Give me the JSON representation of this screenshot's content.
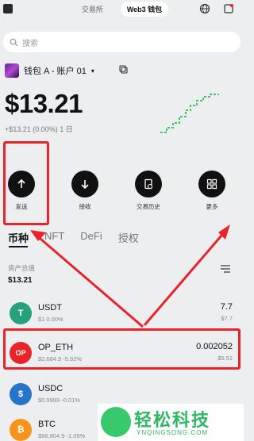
{
  "header": {
    "tabs": [
      {
        "label": "交易所",
        "active": false
      },
      {
        "label": "Web3 钱包",
        "active": true
      }
    ]
  },
  "search": {
    "placeholder": "搜索"
  },
  "account": {
    "name": "钱包 A - 账户 01"
  },
  "balance": {
    "total": "$13.21",
    "change": "+$13.21 (0.00%) 1 日"
  },
  "actions": [
    {
      "label": "发送",
      "icon": "arrow-up-icon"
    },
    {
      "label": "接收",
      "icon": "arrow-down-icon"
    },
    {
      "label": "交易历史",
      "icon": "history-icon"
    },
    {
      "label": "更多",
      "icon": "grid-icon"
    }
  ],
  "category_tabs": [
    {
      "label": "币种",
      "active": true
    },
    {
      "label": "NFT",
      "active": false
    },
    {
      "label": "DeFi",
      "active": false
    },
    {
      "label": "授权",
      "active": false
    }
  ],
  "assets": {
    "label": "资产总值",
    "value": "$13.21"
  },
  "tokens": [
    {
      "name": "USDT",
      "sub": "$1 0.00%",
      "amount": "7.7",
      "usd": "$7.7",
      "color": "#26a17b",
      "symbol": "T"
    },
    {
      "name": "OP_ETH",
      "sub": "$2,684.9 -5.92%",
      "amount": "0.002052",
      "usd": "$5.51",
      "color": "#e8232a",
      "symbol": "OP"
    },
    {
      "name": "USDC",
      "sub": "$0.9999 -0.01%",
      "amount": "",
      "usd": "",
      "color": "#2775ca",
      "symbol": "$"
    },
    {
      "name": "BTC",
      "sub": "$96,804.9 -1.09%",
      "amount": "",
      "usd": "",
      "color": "#f7931a",
      "symbol": "₿"
    }
  ],
  "watermark": {
    "text": "轻松科技",
    "url": "YNQINGSONG.COM"
  },
  "colors": {
    "accent": "#e8232a",
    "dark": "#111111",
    "brand": "#2fb863"
  }
}
